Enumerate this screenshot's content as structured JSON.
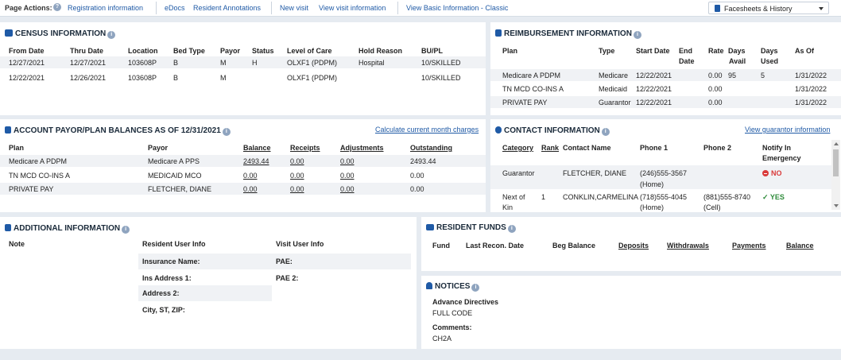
{
  "topbar": {
    "page_actions": "Page Actions:",
    "links": [
      "Registration information",
      "eDocs",
      "Resident Annotations",
      "New visit",
      "View visit information",
      "View Basic Information - Classic"
    ],
    "facesheets": "Facesheets & History"
  },
  "census": {
    "title": "CENSUS INFORMATION",
    "headers": [
      "From Date",
      "Thru Date",
      "Location",
      "Bed Type",
      "Payor",
      "Status",
      "Level of Care",
      "Hold Reason",
      "BU/PL"
    ],
    "rows": [
      [
        "12/27/2021",
        "12/27/2021",
        "103608P",
        "B",
        "M",
        "H",
        "OLXF1 (PDPM)",
        "Hospital",
        "10/SKILLED"
      ],
      [
        "12/22/2021",
        "12/26/2021",
        "103608P",
        "B",
        "M",
        "",
        "OLXF1 (PDPM)",
        "",
        "10/SKILLED"
      ]
    ]
  },
  "reimbursement": {
    "title": "REIMBURSEMENT INFORMATION",
    "headers": [
      "Plan",
      "Type",
      "Start Date",
      "End",
      "Rate",
      "Days",
      "Days",
      "As Of"
    ],
    "headers2": [
      "Date",
      "Avail",
      "Used"
    ],
    "rows": [
      [
        "Medicare A PDPM",
        "Medicare",
        "12/22/2021",
        "",
        "0.00",
        "95",
        "5",
        "1/31/2022"
      ],
      [
        "TN MCD CO-INS A",
        "Medicaid",
        "12/22/2021",
        "",
        "0.00",
        "",
        "",
        "1/31/2022"
      ],
      [
        "PRIVATE PAY",
        "Guarantor",
        "12/22/2021",
        "",
        "0.00",
        "",
        "",
        "1/31/2022"
      ]
    ]
  },
  "balances": {
    "title": "ACCOUNT PAYOR/PLAN BALANCES AS OF 12/31/2021",
    "link": "Calculate current month charges",
    "headers": [
      "Plan",
      "Payor",
      "Balance",
      "Receipts",
      "Adjustments",
      "Outstanding"
    ],
    "rows": [
      [
        "Medicare A PDPM",
        "Medicare A PPS",
        "2493.44",
        "0.00",
        "0.00",
        "2493.44"
      ],
      [
        "TN MCD CO-INS A",
        "MEDICAID MCO",
        "0.00",
        "0.00",
        "0.00",
        "0.00"
      ],
      [
        "PRIVATE PAY",
        "FLETCHER, DIANE",
        "0.00",
        "0.00",
        "0.00",
        "0.00"
      ]
    ]
  },
  "contact": {
    "title": "CONTACT INFORMATION",
    "link": "View guarantor information",
    "headers": [
      "Category",
      "Rank",
      "Contact Name",
      "Phone 1",
      "Phone 2",
      "Notify In",
      "Emergency"
    ],
    "rows": [
      {
        "category": "Guarantor",
        "rank": "",
        "name": "FLETCHER, DIANE",
        "phone1": "(246)555-3567",
        "phone1b": "(Home)",
        "phone2": "",
        "phone2b": "",
        "notify": "NO"
      },
      {
        "category": "Next of",
        "category2": "Kin",
        "rank": "1",
        "name": "CONKLIN,CARMELINA",
        "phone1": "(718)555-4045",
        "phone1b": "(Home)",
        "phone2": "(881)555-8740",
        "phone2b": "(Cell)",
        "notify": "YES"
      }
    ]
  },
  "additional": {
    "title": "ADDITIONAL INFORMATION",
    "headers": [
      "Note",
      "Resident User Info",
      "Visit User Info"
    ],
    "resident_fields": [
      "Insurance Name:",
      "Ins Address 1:",
      "Address 2:",
      "City, ST, ZIP:"
    ],
    "visit_fields": [
      "PAE:",
      "PAE 2:"
    ]
  },
  "funds": {
    "title": "RESIDENT FUNDS",
    "headers": [
      "Fund",
      "Last Recon. Date",
      "Beg Balance",
      "Deposits",
      "Withdrawals",
      "Payments",
      "Balance"
    ]
  },
  "notices": {
    "title": "NOTICES",
    "advance_label": "Advance Directives",
    "advance_value": "FULL CODE",
    "comments_label": "Comments:",
    "comments_value": "CH2A"
  },
  "colors": {
    "link": "#1f5aa6",
    "background": "#e6ebf1",
    "alt_row": "#f0f2f5",
    "no": "#d93a3a",
    "yes": "#2e8b3a"
  }
}
